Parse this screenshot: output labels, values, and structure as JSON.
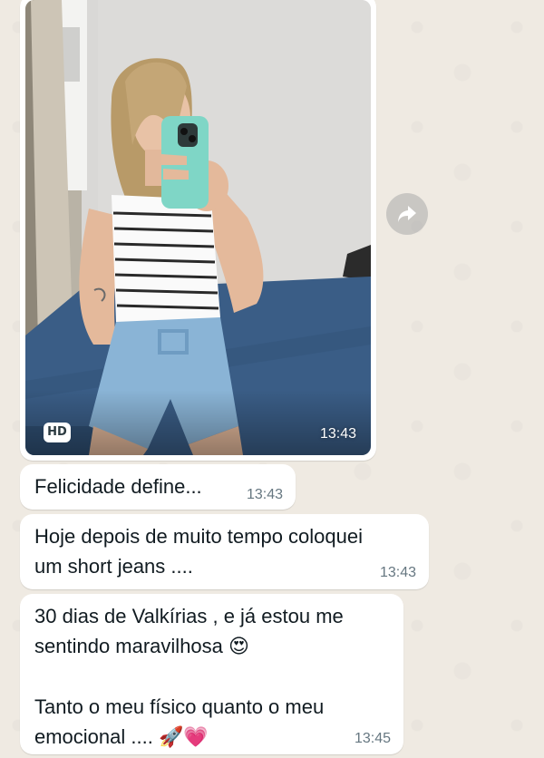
{
  "chat": {
    "image_message": {
      "hd_badge": "HD",
      "time": "13:43"
    },
    "messages": [
      {
        "lines": [
          "Felicidade define..."
        ],
        "time": "13:43"
      },
      {
        "lines": [
          "Hoje depois de muito tempo coloquei",
          "um short jeans ...."
        ],
        "time": "13:43"
      },
      {
        "line1": "30 dias de Valkírias , e já estou me",
        "line2_text": "sentindo maravilhosa ",
        "line2_emoji": "😍",
        "line4": "Tanto o meu físico quanto o meu",
        "line5_text": "emocional .... ",
        "line5_emoji": "🚀💗",
        "time": "13:45"
      }
    ]
  },
  "colors": {
    "background": "#efeae2",
    "bubble": "#ffffff",
    "timestamp": "#667781",
    "text": "#111b21"
  },
  "icons": {
    "forward": "forward-arrow-icon"
  }
}
